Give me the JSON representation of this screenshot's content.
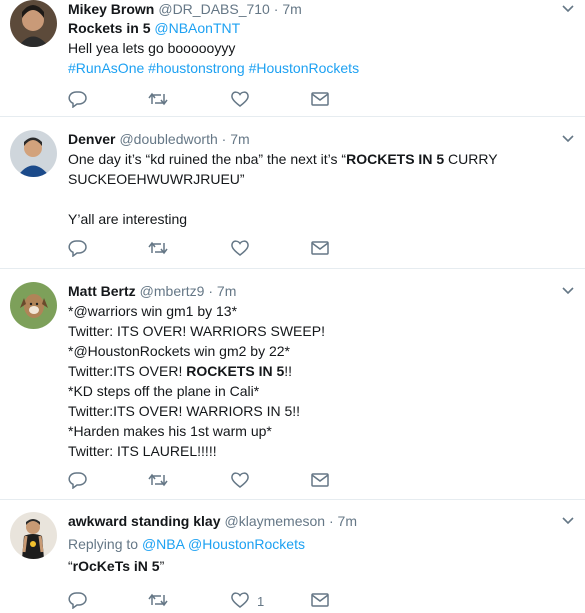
{
  "tweets": [
    {
      "name": "Mikey Brown",
      "handle": "@DR_DABS_710",
      "time": "7m",
      "lines": [
        [
          {
            "t": "Rockets in 5 ",
            "s": "strong"
          },
          {
            "t": "@NBAonTNT",
            "s": "link"
          }
        ],
        [
          {
            "t": "Hell yea lets go boooooyyy",
            "s": ""
          }
        ],
        [
          {
            "t": "#RunAsOne #houstonstrong #HoustonRockets",
            "s": "link"
          }
        ]
      ]
    },
    {
      "name": "Denver",
      "handle": "@doubledworth",
      "time": "7m",
      "lines": [
        [
          {
            "t": "One day it’s “kd ruined the nba” the next it’s “",
            "s": ""
          },
          {
            "t": "ROCKETS IN 5",
            "s": "strong"
          },
          {
            "t": " CURRY",
            "s": ""
          }
        ],
        [
          {
            "t": "SUCKEOEHWUWRJRUEU”",
            "s": ""
          }
        ],
        [
          {
            "t": "",
            "s": ""
          }
        ],
        [
          {
            "t": "Y’all are interesting",
            "s": ""
          }
        ]
      ]
    },
    {
      "name": "Matt Bertz",
      "handle": "@mbertz9",
      "time": "7m",
      "lines": [
        [
          {
            "t": "*@warriors win gm1 by 13*",
            "s": ""
          }
        ],
        [
          {
            "t": "Twitter: ITS OVER! WARRIORS SWEEP!",
            "s": ""
          }
        ],
        [
          {
            "t": "*@HoustonRockets win gm2 by 22*",
            "s": ""
          }
        ],
        [
          {
            "t": "Twitter:ITS OVER! ",
            "s": ""
          },
          {
            "t": "ROCKETS IN 5",
            "s": "strong"
          },
          {
            "t": "!!",
            "s": ""
          }
        ],
        [
          {
            "t": "*KD steps off the plane in Cali*",
            "s": ""
          }
        ],
        [
          {
            "t": "Twitter:ITS OVER! WARRIORS IN 5!!",
            "s": ""
          }
        ],
        [
          {
            "t": "*Harden makes his 1st warm up*",
            "s": ""
          }
        ],
        [
          {
            "t": "Twitter: ITS LAUREL!!!!!",
            "s": ""
          }
        ]
      ]
    },
    {
      "name": "awkward standing klay",
      "handle": "@klaymemeson",
      "time": "7m",
      "replying_prefix": "Replying to",
      "replying_to": "@NBA @HoustonRockets",
      "lines": [
        [
          {
            "t": "“",
            "s": ""
          },
          {
            "t": "rOcKeTs iN 5",
            "s": "strong"
          },
          {
            "t": "”",
            "s": ""
          }
        ]
      ],
      "like_count": "1"
    }
  ],
  "colors": {
    "text": "#14171a",
    "muted": "#657786",
    "link": "#1da1f2",
    "border": "#e6ecf0"
  },
  "icons": [
    "reply-icon",
    "retweet-icon",
    "like-icon",
    "direct-message-icon",
    "chevron-down-icon"
  ]
}
